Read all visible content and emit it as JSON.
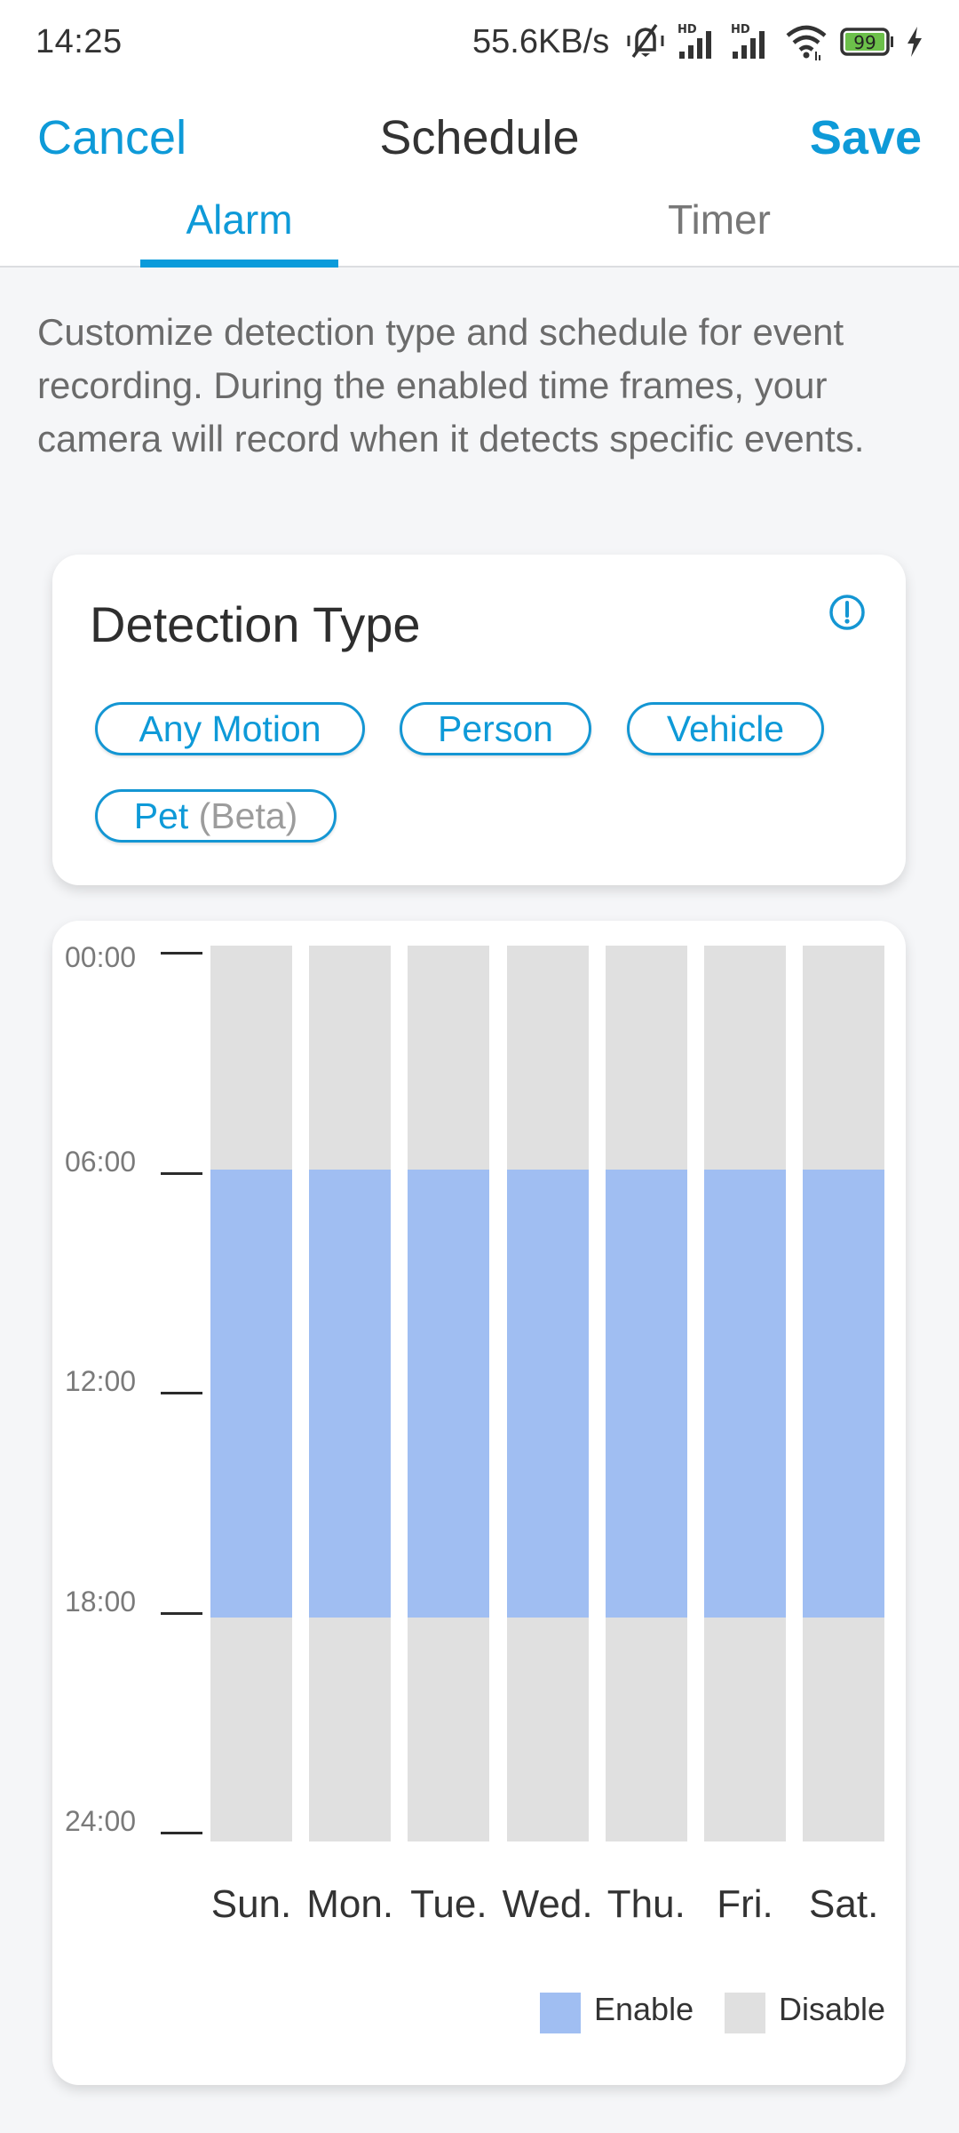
{
  "status_bar": {
    "time": "14:25",
    "network_speed": "55.6KB/s",
    "icons": [
      "mute-icon",
      "signal-hd-icon",
      "signal-hd-icon",
      "wifi-icon",
      "battery-icon",
      "charging-icon"
    ],
    "battery_level": "99",
    "battery_color": "#6cc04a"
  },
  "nav": {
    "cancel_label": "Cancel",
    "title": "Schedule",
    "save_label": "Save",
    "accent_color": "#0e9ad8"
  },
  "tabs": [
    {
      "label": "Alarm",
      "active": true
    },
    {
      "label": "Timer",
      "active": false
    }
  ],
  "description": "Customize detection type and schedule for event recording. During the enabled time frames, your camera will record when it detects specific events.",
  "detection": {
    "heading": "Detection Type",
    "info_icon": "info-icon",
    "chips": [
      {
        "label": "Any Motion",
        "suffix": ""
      },
      {
        "label": "Person",
        "suffix": ""
      },
      {
        "label": "Vehicle",
        "suffix": ""
      },
      {
        "label": "Pet",
        "suffix": "(Beta)"
      }
    ]
  },
  "chart_data": {
    "type": "bar",
    "subtype": "weekly-schedule-range",
    "categories": [
      "Sun.",
      "Mon.",
      "Tue.",
      "Wed.",
      "Thu.",
      "Fri.",
      "Sat."
    ],
    "y_ticks": [
      "00:00",
      "06:00",
      "12:00",
      "18:00",
      "24:00"
    ],
    "ylim": [
      0,
      24
    ],
    "y_unit": "hour",
    "enabled_ranges": [
      [
        [
          6,
          18
        ]
      ],
      [
        [
          6,
          18
        ]
      ],
      [
        [
          6,
          18
        ]
      ],
      [
        [
          6,
          18
        ]
      ],
      [
        [
          6,
          18
        ]
      ],
      [
        [
          6,
          18
        ]
      ],
      [
        [
          6,
          18
        ]
      ]
    ],
    "colors": {
      "enable": "#a0bef2",
      "disable": "#e0e0e0"
    },
    "legend": [
      {
        "label": "Enable",
        "key": "enable"
      },
      {
        "label": "Disable",
        "key": "disable"
      }
    ],
    "legend_position": "bottom-right",
    "grid": false
  }
}
